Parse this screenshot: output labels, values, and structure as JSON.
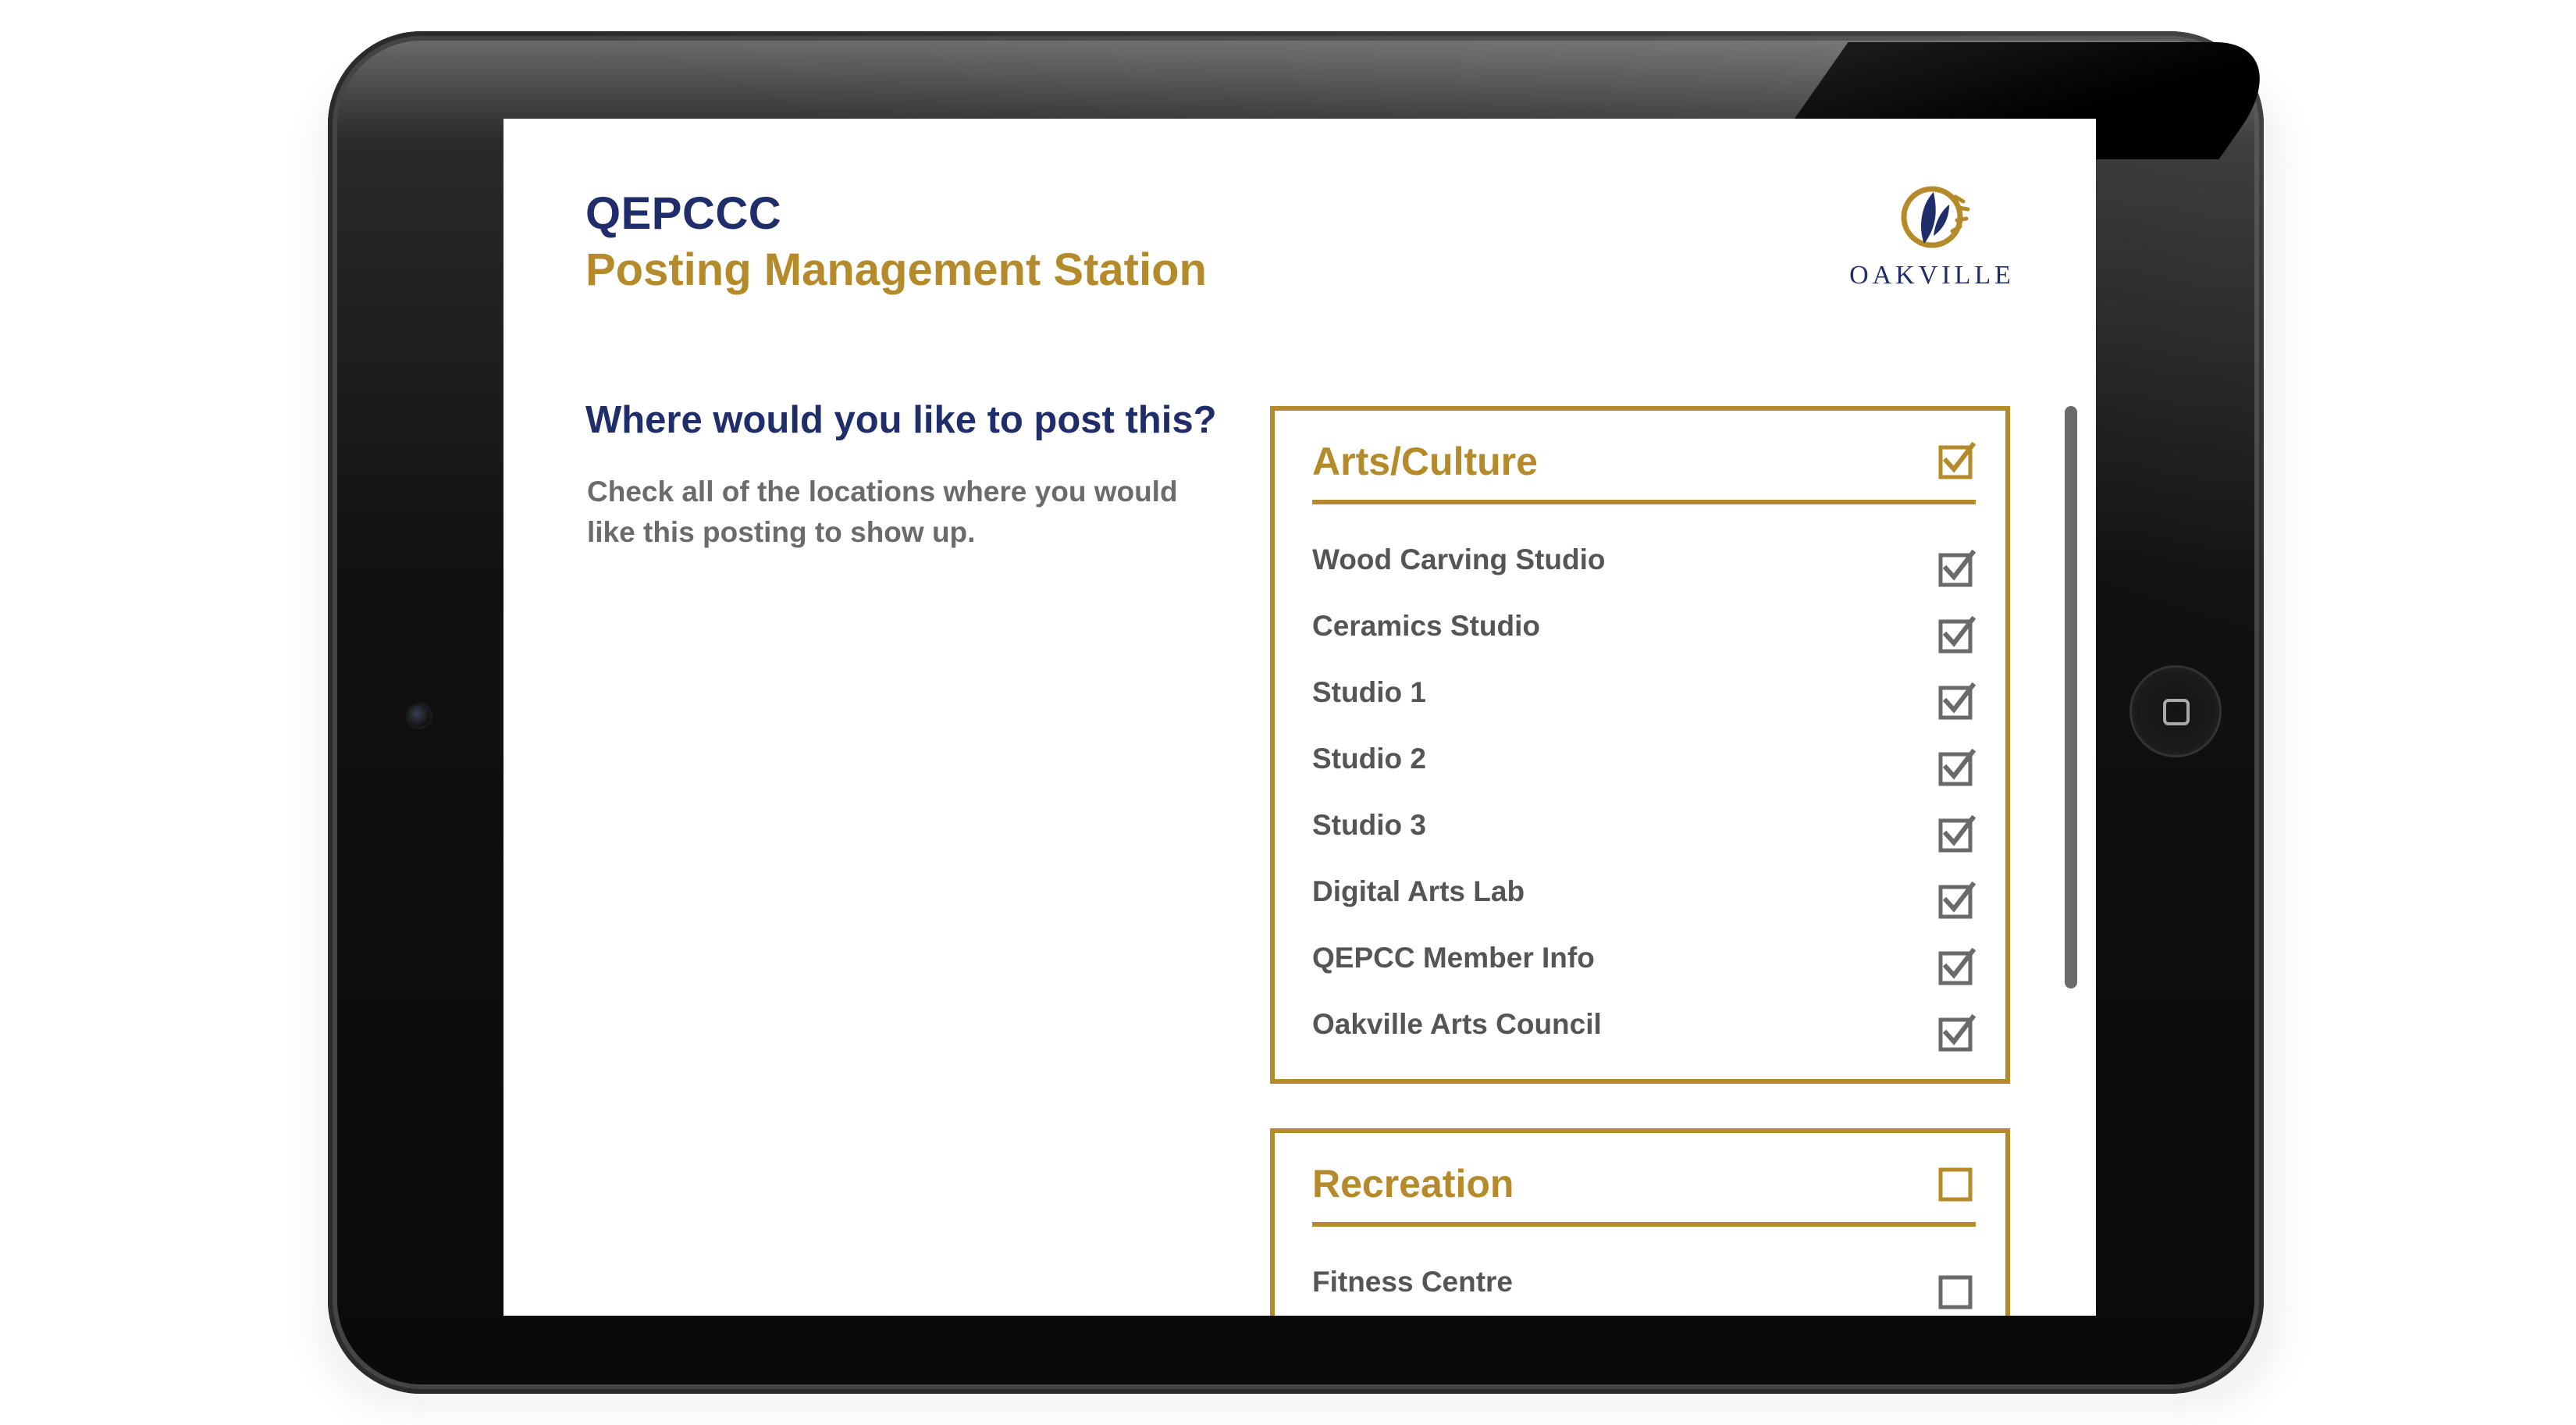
{
  "header": {
    "title": "QEPCCC",
    "subtitle": "Posting Management Station",
    "logo_text": "OAKVILLE"
  },
  "main": {
    "question": "Where would you like to post this?",
    "instructions": "Check all of the locations where you would like this posting to show up."
  },
  "groups": [
    {
      "title": "Arts/Culture",
      "checked": true,
      "items": [
        {
          "label": "Wood Carving Studio",
          "checked": true
        },
        {
          "label": "Ceramics Studio",
          "checked": true
        },
        {
          "label": "Studio 1",
          "checked": true
        },
        {
          "label": "Studio 2",
          "checked": true
        },
        {
          "label": "Studio 3",
          "checked": true
        },
        {
          "label": "Digital Arts Lab",
          "checked": true
        },
        {
          "label": "QEPCC Member Info",
          "checked": true
        },
        {
          "label": "Oakville Arts Council",
          "checked": true
        }
      ]
    },
    {
      "title": "Recreation",
      "checked": false,
      "items": [
        {
          "label": "Fitness Centre",
          "checked": false
        }
      ]
    }
  ],
  "colors": {
    "navy": "#1f2d6b",
    "gold": "#b48a2a",
    "gray_text": "#555555",
    "checkbox_gray": "#6a6a6a"
  },
  "icons": {
    "logo": "oakville-leaf-logo",
    "checkbox_checked": "checkbox-checked-icon",
    "checkbox_empty": "checkbox-empty-icon",
    "home_button": "home-button-icon"
  }
}
